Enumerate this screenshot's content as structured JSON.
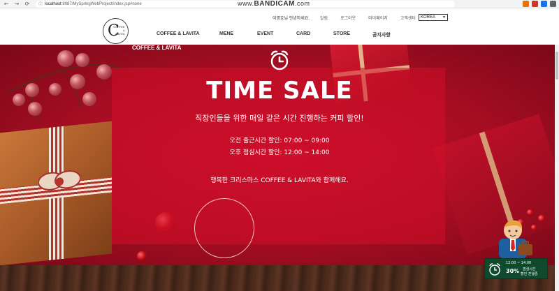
{
  "browser": {
    "url_host": "localhost",
    "url_path": ":8087/MySpringWebProject/index.jsp#none",
    "back_icon": "arrow-left-icon",
    "forward_icon": "arrow-right-icon",
    "reload_icon": "reload-icon",
    "watermark_prefix": "www.",
    "watermark_brand": "BANDICAM",
    "watermark_suffix": ".com"
  },
  "header": {
    "logo_letter": "C",
    "logo_text_1": "COFFEE",
    "logo_text_2": "&",
    "logo_text_3": "LAVITA",
    "greeting": "이명호님 안녕하세요.",
    "util_links": [
      "알림",
      "로그아웃",
      "마이페이지",
      "고객센터"
    ],
    "language": "KOREA",
    "nav": [
      "COFFEE & LAVITA",
      "MENE",
      "EVENT",
      "CARD",
      "STORE",
      "공지사항"
    ]
  },
  "hero": {
    "brand": "COFFEE & LAVITA",
    "title": "TIME SALE",
    "subtitle": "직장인들을 위한 매일 같은 시간 진행하는 커피 할인!",
    "morning": "오전 출근시간 할인: 07:00 ~ 09:00",
    "lunch": "오후 점심시간 할인: 12:00 ~ 14:00",
    "footer": "행복한 크리스마스 COFFEE & LAVITA와 함께해요."
  },
  "promo": {
    "time": "12:00 ~ 14:00",
    "percent": "30%",
    "label_line1": "점심시간",
    "label_line2": "할인 진행중"
  },
  "colors": {
    "hero_red": "#c8102e",
    "promo_green": "#0f4a2c"
  }
}
